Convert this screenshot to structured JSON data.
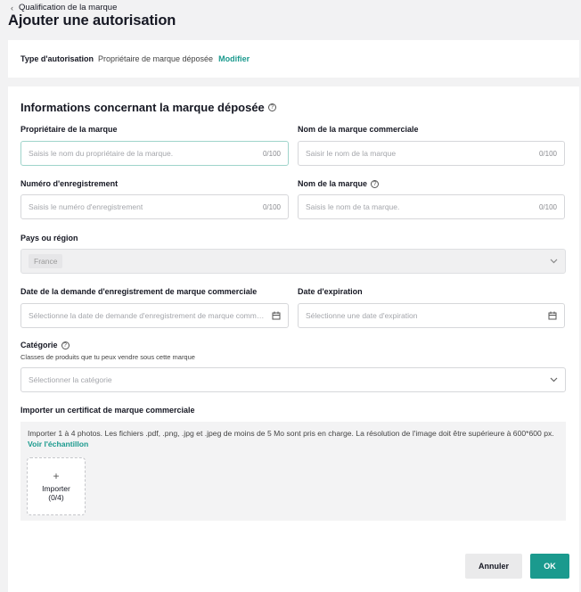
{
  "breadcrumb": {
    "back_label": "Qualification de la marque"
  },
  "page": {
    "title": "Ajouter une autorisation"
  },
  "type_card": {
    "label": "Type d'autorisation",
    "value": "Propriétaire de marque déposée",
    "modify_link": "Modifier"
  },
  "form": {
    "section_title": "Informations concernant la marque déposée",
    "owner": {
      "label": "Propriétaire de la marque",
      "placeholder": "Saisis le nom du propriétaire de la marque.",
      "counter": "0/100"
    },
    "trade_name": {
      "label": "Nom de la marque commerciale",
      "placeholder": "Saisir le nom de la marque",
      "counter": "0/100"
    },
    "reg_number": {
      "label": "Numéro d'enregistrement",
      "placeholder": "Saisis le numéro d'enregistrement",
      "counter": "0/100"
    },
    "brand_name": {
      "label": "Nom de la marque",
      "placeholder": "Saisis le nom de ta marque.",
      "counter": "0/100"
    },
    "country": {
      "label": "Pays ou région",
      "value": "France"
    },
    "application_date": {
      "label": "Date de la demande d'enregistrement de marque commerciale",
      "placeholder": "Sélectionne la date de demande d'enregistrement de marque commerciale"
    },
    "expiry_date": {
      "label": "Date d'expiration",
      "placeholder": "Sélectionne une date d'expiration"
    },
    "category": {
      "label": "Catégorie",
      "hint": "Classes de produits que tu peux vendre sous cette marque",
      "placeholder": "Sélectionner la catégorie"
    },
    "certificate": {
      "label": "Importer un certificat de marque commerciale",
      "description": "Importer 1 à 4 photos. Les fichiers .pdf, .png, .jpg et .jpeg de moins de 5 Mo sont pris en charge. La résolution de l'image doit être supérieure à 600*600 px.",
      "sample_link": "Voir l'échantillon",
      "upload_label": "Importer",
      "upload_count": "(0/4)"
    }
  },
  "actions": {
    "cancel": "Annuler",
    "ok": "OK"
  },
  "colors": {
    "accent": "#1b9a8e",
    "background": "#f2f2f3"
  }
}
